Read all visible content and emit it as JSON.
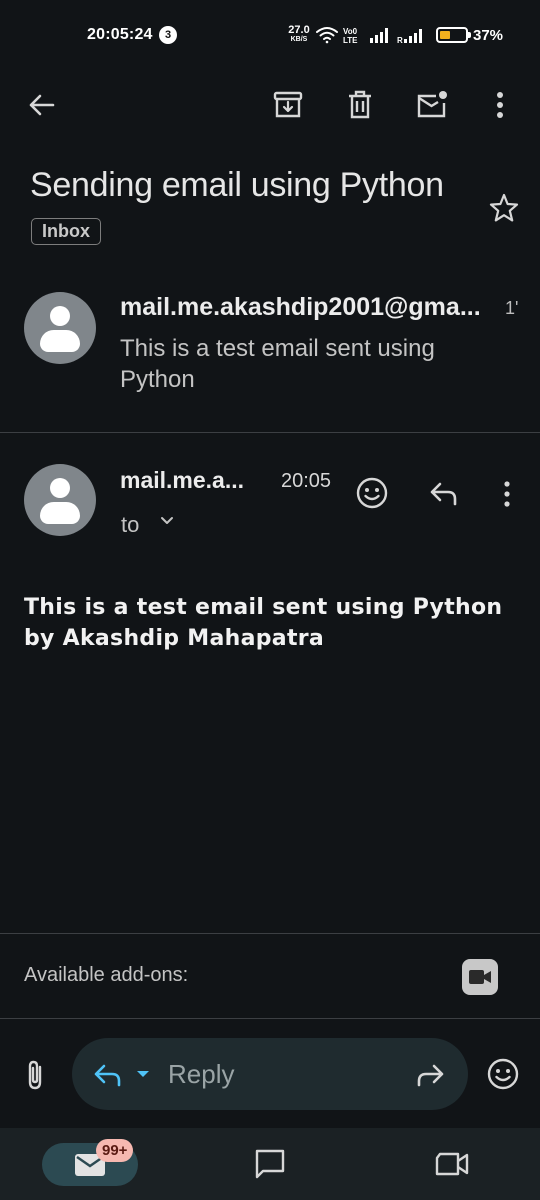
{
  "status_bar": {
    "time": "20:05:24",
    "notification_count": "3",
    "net_speed_value": "27.0",
    "net_speed_unit": "KB/S",
    "battery_percent": "37%",
    "icons": [
      "wifi-icon",
      "volte-icon",
      "signal-icon",
      "roaming-signal-icon",
      "battery-icon"
    ]
  },
  "toolbar": {
    "icons": [
      "back-arrow-icon",
      "archive-icon",
      "delete-icon",
      "mark-unread-icon",
      "more-vert-icon"
    ]
  },
  "thread": {
    "subject": "Sending email using Python",
    "label": "Inbox",
    "star_icon": "star-outline-icon"
  },
  "collapsed_message": {
    "sender": "mail.me.akashdip2001@gma...",
    "time": "1'",
    "snippet": "This is a test email sent using Python"
  },
  "expanded_message": {
    "sender": "mail.me.a...",
    "time": "20:05",
    "recipients_label": "to",
    "body": "This is a test email sent using Python by Akashdip Mahapatra"
  },
  "addons": {
    "label": "Available add-ons:",
    "icon": "meet-video-icon"
  },
  "reply_bar": {
    "reply_label": "Reply",
    "icons": [
      "attach-icon",
      "reply-icon",
      "reply-menu-icon",
      "forward-icon",
      "emoji-icon"
    ]
  },
  "bottom_nav": {
    "mail_badge": "99+",
    "items": [
      "mail-icon",
      "chat-icon",
      "meet-icon"
    ]
  }
}
